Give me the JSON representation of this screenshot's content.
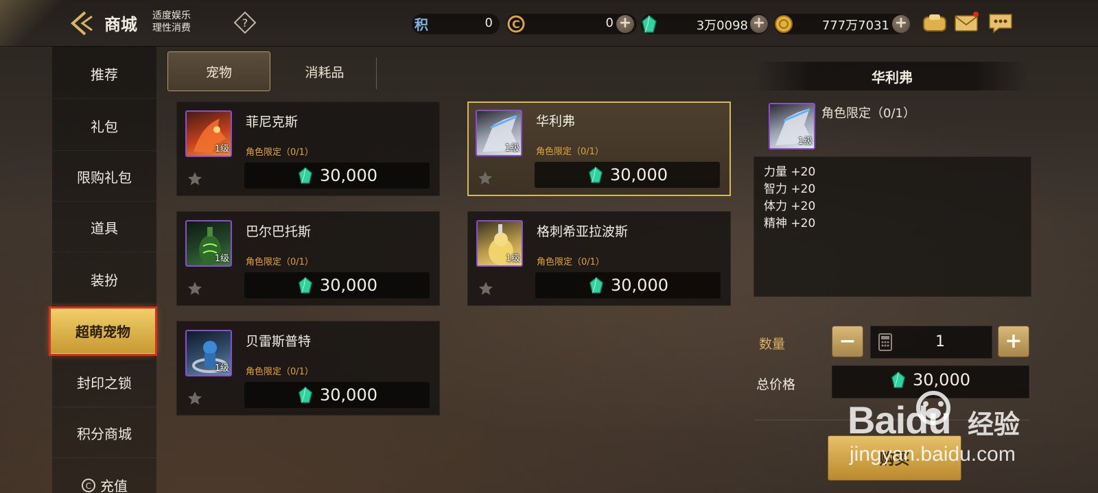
{
  "header": {
    "title": "商城",
    "slogan_line1": "适度娱乐",
    "slogan_line2": "理性消费",
    "currencies": [
      {
        "icon": "points-icon",
        "glyph": "积",
        "value": "0"
      },
      {
        "icon": "coin-c-icon",
        "value": "0"
      },
      {
        "icon": "green-gem-icon",
        "value": "3万0098"
      },
      {
        "icon": "gold-coin-icon",
        "value": "777万7031"
      }
    ]
  },
  "sidebar": {
    "items": [
      {
        "label": "推荐"
      },
      {
        "label": "礼包"
      },
      {
        "label": "限购礼包"
      },
      {
        "label": "道具"
      },
      {
        "label": "装扮"
      },
      {
        "label": "超萌宠物"
      },
      {
        "label": "封印之锁"
      },
      {
        "label": "积分商城"
      },
      {
        "label": "充值"
      }
    ],
    "active_index": 5
  },
  "tabs": [
    {
      "label": "宠物",
      "active": true
    },
    {
      "label": "消耗品",
      "active": false
    }
  ],
  "products": [
    {
      "name": "菲尼克斯",
      "level": "1级",
      "limit": "角色限定（0/1）",
      "price": "30,000",
      "selected": false
    },
    {
      "name": "华利弗",
      "level": "1级",
      "limit": "角色限定（0/1）",
      "price": "30,000",
      "selected": true
    },
    {
      "name": "巴尔巴托斯",
      "level": "1级",
      "limit": "角色限定（0/1）",
      "price": "30,000",
      "selected": false
    },
    {
      "name": "格刺希亚拉波斯",
      "level": "1级",
      "limit": "角色限定（0/1）",
      "price": "30,000",
      "selected": false
    },
    {
      "name": "贝雷斯普特",
      "level": "1级",
      "limit": "角色限定（0/1）",
      "price": "30,000",
      "selected": false
    }
  ],
  "detail": {
    "name": "华利弗",
    "level": "1级",
    "limit": "角色限定（0/1）",
    "stats": [
      "力量 +20",
      "智力 +20",
      "体力 +20",
      "精神 +20"
    ],
    "quantity_label": "数量",
    "quantity": "1",
    "total_label": "总价格",
    "total_price": "30,000",
    "buy_label": "购买"
  },
  "watermark": {
    "logo": "Baidu",
    "cn": "经验",
    "url": "jingyan.baidu.com"
  },
  "colors": {
    "accent_gold": "#d8b85c",
    "limit_orange": "#e5a43a",
    "gem_green": "#2fd3a0",
    "highlight_red": "#e02a1a",
    "portrait_purple": "#8a4fcf"
  }
}
